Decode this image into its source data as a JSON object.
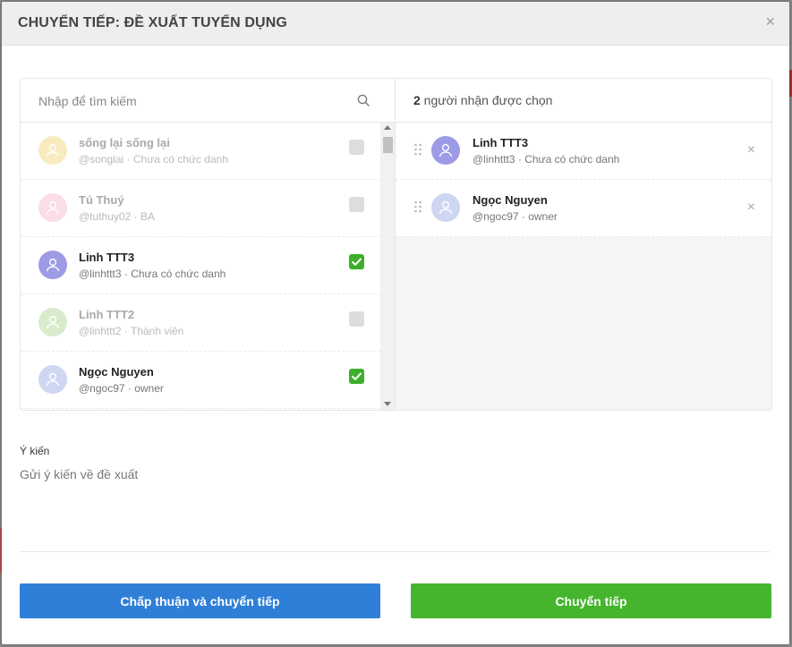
{
  "modal": {
    "title": "CHUYỂN TIẾP: ĐỀ XUẤT TUYỂN DỤNG",
    "close_glyph": "×"
  },
  "search": {
    "placeholder": "Nhập để tìm kiếm"
  },
  "candidates": [
    {
      "name": "sống lại sống lại",
      "handle": "@songlai · Chưa có chức danh",
      "avatar_color": "#f3dc8a",
      "selected": false
    },
    {
      "name": "Tú Thuý",
      "handle": "@tuthuy02 · BA",
      "avatar_color": "#f6c2d3",
      "selected": false
    },
    {
      "name": "Linh TTT3",
      "handle": "@linhttt3 · Chưa có chức danh",
      "avatar_color": "#9d9ae6",
      "selected": true
    },
    {
      "name": "Linh TTT2",
      "handle": "@linhttt2 · Thành viên",
      "avatar_color": "#b9dda4",
      "selected": false
    },
    {
      "name": "Ngọc Nguyen",
      "handle": "@ngoc97 · owner",
      "avatar_color": "#ced6f2",
      "selected": true
    }
  ],
  "selected_header": {
    "count": "2",
    "label": " người nhận được chọn"
  },
  "selected": [
    {
      "name": "Linh TTT3",
      "handle": "@linhttt3 · Chưa có chức danh",
      "avatar_color": "#9d9ae6",
      "remove_glyph": "×"
    },
    {
      "name": "Ngọc Nguyen",
      "handle": "@ngoc97 · owner",
      "avatar_color": "#ced6f2",
      "remove_glyph": "×"
    }
  ],
  "comment": {
    "label": "Ý kiến",
    "placeholder": "Gửi ý kiến về đề xuất"
  },
  "buttons": {
    "approve": "Chấp thuận và chuyển tiếp",
    "forward": "Chuyển tiếp"
  },
  "colors": {
    "approve": "#2f7fd8",
    "forward": "#45b52e",
    "check": "#3dae2b"
  }
}
